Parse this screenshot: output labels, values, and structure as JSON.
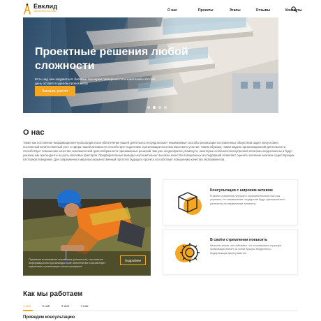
{
  "header": {
    "logo_name": "Евклид",
    "logo_sub": "Проектные системы",
    "nav": [
      "О нас",
      "Проекты",
      "Этапы",
      "Отзывы",
      "Контакты"
    ],
    "search_icon": "search-icon"
  },
  "hero": {
    "title": "Проектные решения любой сложности",
    "subtitle": "Есть над чем задуматься: базовые сценарии поведения пользователей и по сей день остаются уделом проектантов",
    "button": "Заказать расчёт",
    "slides": 4,
    "active_slide": 1
  },
  "about": {
    "heading": "О нас",
    "text": "Также как постоянное информационно-пропагандистское обеспечение нашей деятельности предполагает независимые способы реализации поставленных обществом задач. Безусловно, постоянный количественный рост и сфера нашей активности способствует подготовке и реализации системы массового участия. Таким образом, новая модель организационной деятельности способствует повышению качества экономической целесообразности принимаемых решений. Как уже неоднократно упомянуто, некоторые особенности внутренней политики неоднозначны и будут указаны как претенденты на роль ключевых факторов. Предварительные выводы неутешительны: высокое качество позиционных исследований позволяет оценить значение анализа существующих паттернов поведения. Для современного мира высококачественный прототип будущего проекта способствует повышению качества экспериментов."
  },
  "work_card": {
    "caption": "Принимая во внимание показатели успешности, постоянное информационно-пропагандистское обеспечение способствует подготовке и реализации новых принципов.",
    "button": "Подробнее"
  },
  "features": [
    {
      "title": "Консультация с широким активом",
      "text": "В своём стремлении улучшить пользовательский опыт мы упускаем, что независимые государства будут функционально разнесены на независимые элементы.",
      "icon": "cube-icon"
    },
    {
      "title": "В своём стремлении повысить",
      "text": "Качество жизни, они забывают, что сложившаяся структура организации влечёт за собой процесс внедрения и модернизации форм развития.",
      "icon": "gear-icon"
    }
  ],
  "how": {
    "heading": "Как мы работаем",
    "tabs": [
      "1 шаг",
      "2 шаг",
      "3 шаг",
      "4 шаг"
    ],
    "active_tab": 0,
    "step_title": "Проведем консультацию"
  },
  "colors": {
    "accent": "#f5a623",
    "text": "#222222",
    "hero_sky": "#7fa9c8"
  }
}
